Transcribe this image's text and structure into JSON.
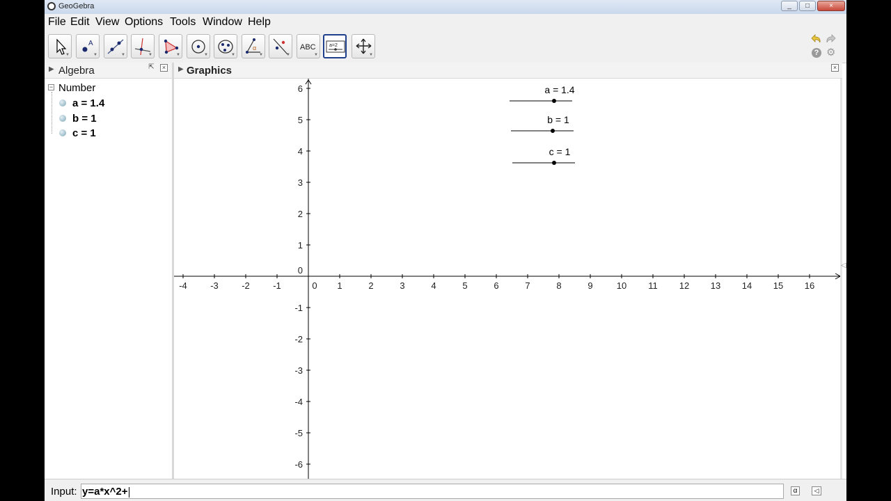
{
  "window": {
    "title": "GeoGebra",
    "controls": [
      "_",
      "□",
      "×"
    ]
  },
  "menu": [
    "File",
    "Edit",
    "View",
    "Options",
    "Tools",
    "Window",
    "Help"
  ],
  "toolbar": {
    "tools": [
      {
        "name": "move-tool-icon"
      },
      {
        "name": "point-tool-icon"
      },
      {
        "name": "line-tool-icon"
      },
      {
        "name": "perpendicular-line-tool-icon"
      },
      {
        "name": "polygon-tool-icon"
      },
      {
        "name": "circle-tool-icon"
      },
      {
        "name": "ellipse-tool-icon"
      },
      {
        "name": "angle-tool-icon"
      },
      {
        "name": "reflect-tool-icon"
      },
      {
        "name": "text-tool-icon",
        "label": "ABC"
      },
      {
        "name": "slider-tool-icon",
        "label": "a=2",
        "selected": true
      },
      {
        "name": "move-graphics-view-tool-icon"
      }
    ],
    "selected_index": 10
  },
  "algebra_view": {
    "title": "Algebra",
    "group": "Number",
    "items": [
      {
        "label": "a = 1.4"
      },
      {
        "label": "b = 1"
      },
      {
        "label": "c = 1"
      }
    ]
  },
  "graphics_view": {
    "title": "Graphics",
    "x_ticks": [
      "-4",
      "-3",
      "-2",
      "-1",
      "0",
      "1",
      "2",
      "3",
      "4",
      "5",
      "6",
      "7",
      "8",
      "9",
      "10",
      "11",
      "12",
      "13",
      "14",
      "15",
      "16"
    ],
    "y_ticks": [
      "6",
      "5",
      "4",
      "3",
      "2",
      "1",
      "0",
      "-1",
      "-2",
      "-3",
      "-4",
      "-5",
      "-6"
    ],
    "sliders": [
      {
        "label": "a = 1.4",
        "name": "a",
        "value": 1.4
      },
      {
        "label": "b = 1",
        "name": "b",
        "value": 1
      },
      {
        "label": "c = 1",
        "name": "c",
        "value": 1
      }
    ]
  },
  "input_bar": {
    "label": "Input:",
    "value": "y=a*x^2+"
  },
  "colors": {
    "selected_tool_border": "#1e3f8c",
    "axis": "#000000",
    "tick_label": "#222222"
  }
}
